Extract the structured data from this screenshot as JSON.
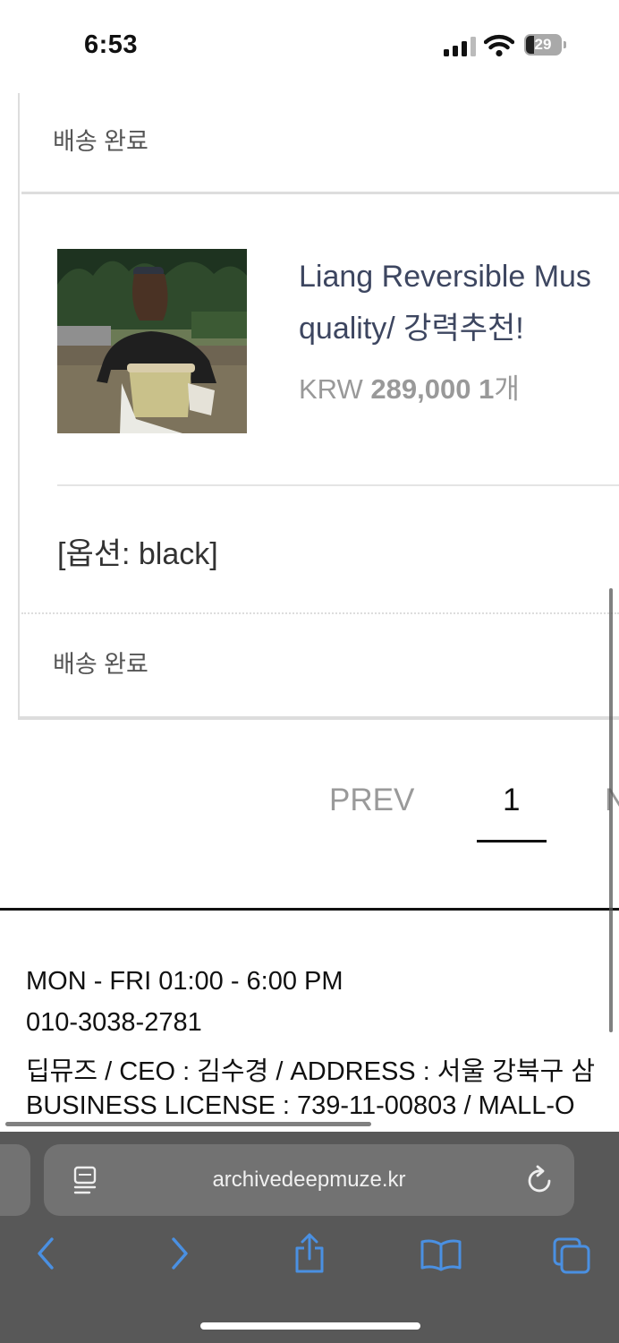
{
  "status_bar": {
    "time": "6:53",
    "battery_level": "29",
    "signal_bars": 3,
    "icons": [
      "signal-icon",
      "wifi-icon",
      "battery-icon"
    ]
  },
  "order": {
    "top_status": "배송 완료",
    "product": {
      "title_line1": "Liang Reversible Mus",
      "title_line2": "quality/ 강력추천!",
      "currency": "KRW",
      "price": "289,000",
      "quantity": "1",
      "quantity_unit": "개"
    },
    "option": "[옵션: black]",
    "bottom_status": "배송 완료"
  },
  "pagination": {
    "prev_label": "PREV",
    "current_page": "1",
    "next_label_partial": "N"
  },
  "footer": {
    "hours": "MON - FRI  01:00 -  6:00 PM",
    "phone": "010-3038-2781",
    "company": "딥뮤즈 / CEO : 김수경 / ADDRESS : 서울 강북구 삼",
    "license": "BUSINESS LICENSE : 739-11-00803 / MALL-O"
  },
  "browser": {
    "url": "archivedeepmuze.kr",
    "icons": [
      "reader-icon",
      "reload-icon",
      "back-icon",
      "forward-icon",
      "share-icon",
      "bookmarks-icon",
      "tabs-icon"
    ],
    "accent_color": "#4a90e2"
  }
}
